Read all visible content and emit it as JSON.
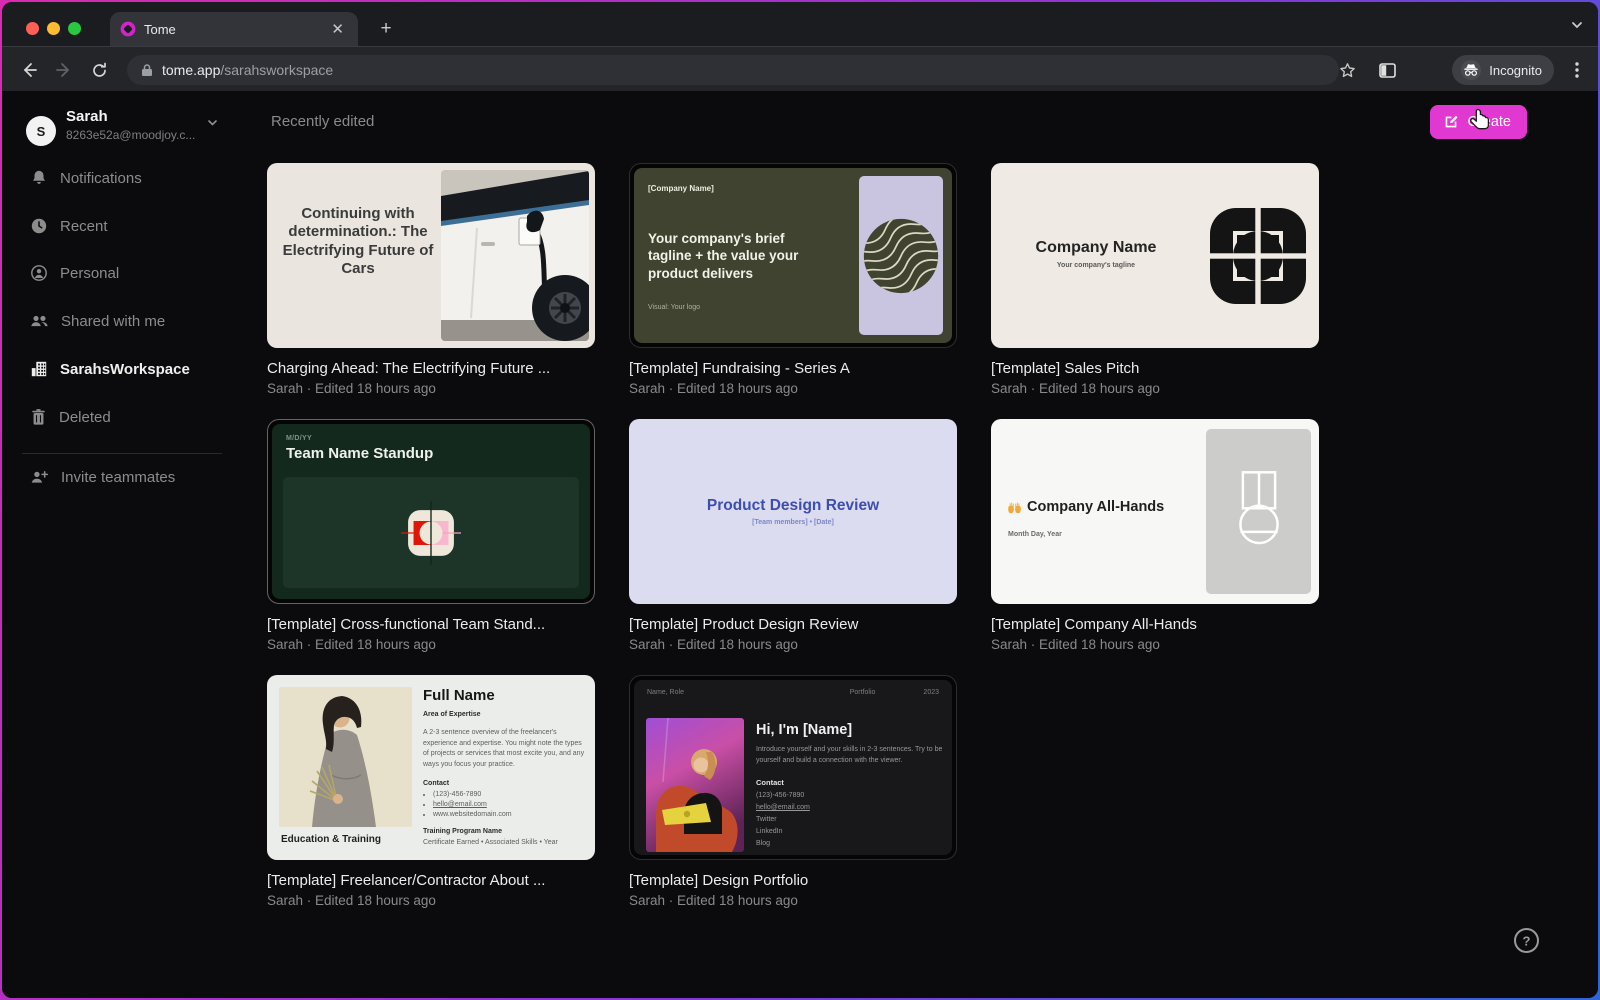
{
  "browser": {
    "tab_title": "Tome",
    "url_host": "tome.app",
    "url_path": "/sarahsworkspace",
    "incognito_label": "Incognito"
  },
  "colors": {
    "accent": "#E138D2",
    "favicon": "#D224C8"
  },
  "icons": {
    "favicon": "tome-diamond",
    "back": "arrow-left",
    "forward": "arrow-right",
    "reload": "refresh",
    "lock": "padlock",
    "bookmark": "star-outline",
    "side_panel": "panel",
    "incognito": "hat-and-glasses",
    "menu": "kebab",
    "bell": "notifications",
    "clock": "recent",
    "person": "personal",
    "people": "shared",
    "building": "workspace",
    "trash": "deleted",
    "person_plus": "invite",
    "create": "pencil-square",
    "help": "question-circle",
    "cursor": "pointer-hand"
  },
  "sidebar": {
    "user": {
      "name": "Sarah",
      "email": "8263e52a@moodjoy.c...",
      "avatar_initial": "S"
    },
    "items": [
      {
        "label": "Notifications",
        "icon": "bell",
        "active": false
      },
      {
        "label": "Recent",
        "icon": "clock",
        "active": false
      },
      {
        "label": "Personal",
        "icon": "person",
        "active": false
      },
      {
        "label": "Shared with me",
        "icon": "people",
        "active": false
      },
      {
        "label": "SarahsWorkspace",
        "icon": "building",
        "active": true
      },
      {
        "label": "Deleted",
        "icon": "trash",
        "active": false
      }
    ],
    "invite_label": "Invite teammates"
  },
  "header": {
    "section_title": "Recently edited",
    "create_label": "Create"
  },
  "cards": [
    {
      "title": "Charging Ahead: The Electrifying Future ...",
      "meta": "Sarah · Edited 18 hours ago",
      "thumb": {
        "headline": "Continuing with determination.: The Electrifying Future of Cars"
      }
    },
    {
      "title": "[Template] Fundraising - Series A",
      "meta": "Sarah · Edited 18 hours ago",
      "thumb": {
        "company": "[Company Name]",
        "headline": "Your company's brief tagline + the value your product delivers",
        "caption": "Visual: Your logo"
      }
    },
    {
      "title": "[Template] Sales Pitch",
      "meta": "Sarah · Edited 18 hours ago",
      "thumb": {
        "company": "Company Name",
        "tagline": "Your company's tagline"
      }
    },
    {
      "title": "[Template] Cross-functional Team Stand...",
      "meta": "Sarah · Edited 18 hours ago",
      "thumb": {
        "date": "M/D/YY",
        "headline": "Team Name Standup"
      }
    },
    {
      "title": "[Template] Product Design Review",
      "meta": "Sarah · Edited 18 hours ago",
      "thumb": {
        "headline": "Product Design Review",
        "subtitle": "[Team members] • [Date]"
      }
    },
    {
      "title": "[Template] Company All-Hands",
      "meta": "Sarah · Edited 18 hours ago",
      "thumb": {
        "headline": "Company All-Hands",
        "subtitle": "Month Day, Year"
      }
    },
    {
      "title": "[Template] Freelancer/Contractor About ...",
      "meta": "Sarah · Edited 18 hours ago",
      "thumb": {
        "name": "Full Name",
        "expertise_label": "Area of Expertise",
        "overview": "A 2-3 sentence overview of the freelancer's experience and expertise. You might note the types of projects or services that most excite you, and any ways you focus your practice.",
        "contact_label": "Contact",
        "contact_items": [
          "(123)-456-7890",
          "hello@email.com",
          "www.websitedomain.com"
        ],
        "education_label": "Education & Training",
        "training_label": "Training Program Name",
        "training_detail": "Certificate Earned • Associated Skills • Year"
      }
    },
    {
      "title": "[Template] Design Portfolio",
      "meta": "Sarah · Edited 18 hours ago",
      "thumb": {
        "header_left": "Name, Role",
        "header_center": "Portfolio",
        "header_right": "2023",
        "headline": "Hi, I'm [Name]",
        "intro": "Introduce yourself and your skills in 2-3 sentences. Try to be yourself and build a connection with the viewer.",
        "contact_label": "Contact",
        "contact_items": [
          "(123)-456-7890",
          "hello@email.com",
          "Twitter",
          "LinkedIn",
          "Blog"
        ]
      }
    }
  ]
}
